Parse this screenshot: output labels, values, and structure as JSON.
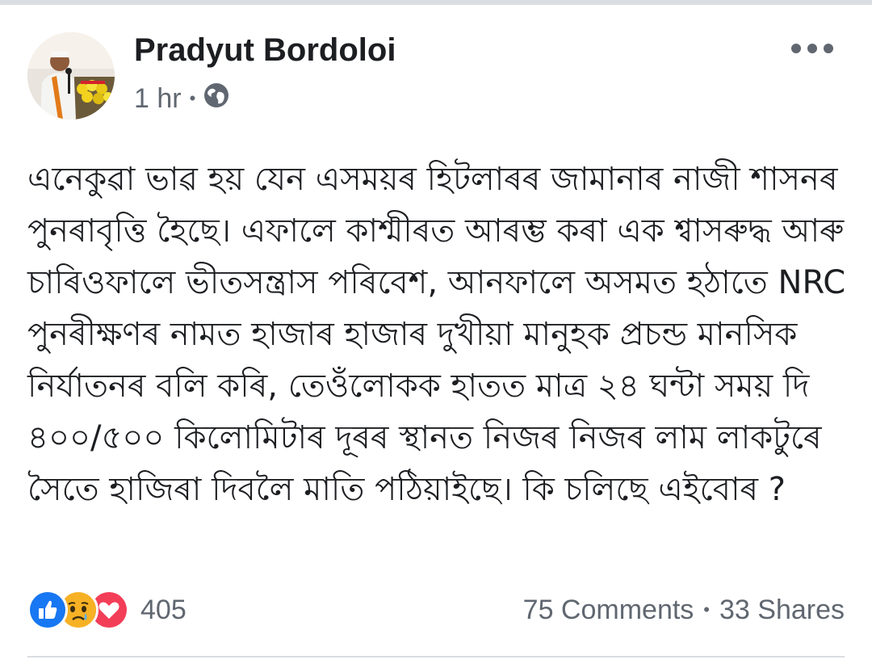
{
  "post": {
    "author": "Pradyut Bordoloi",
    "time": "1 hr",
    "separator": "•",
    "privacy_icon": "globe-icon",
    "text": "এনেকুৱা ভাৱ হয় যেন এসময়ৰ হিটলাৰৰ জামানাৰ নাজী শাসনৰ পুনৰাবৃত্তি হৈছে। এফালে কাশ্মীৰত আৰম্ভ কৰা এক শ্বাসৰুদ্ধ আৰু চাৰিওফালে ভীতসন্ত্ৰাস পৰিবেশ, আনফালে অসমত হঠাতে NRC পুনৰীক্ষণৰ নামত হাজাৰ হাজাৰ দুখীয়া মানুহক প্ৰচন্ড মানসিক নিৰ্যাতনৰ বলি কৰি, তেওঁলোকক হাতত মাত্ৰ ২৪ ঘন্টা সময় দি ৪০০/৫০০ কিলোমিটাৰ দূৰৰ স্থানত নিজৰ নিজৰ লাম লাকটুৰে সৈতে হাজিৰা দিবলৈ মাতি পঠিয়াইছে। কি চলিছে এইবোৰ ?"
  },
  "reactions": {
    "icons": [
      "like-icon",
      "sad-icon",
      "love-icon"
    ],
    "count": "405"
  },
  "stats": {
    "comments": "75 Comments",
    "separator": "•",
    "shares": "33 Shares"
  },
  "colors": {
    "text": "#1c1e21",
    "secondary": "#606770",
    "like_blue": "#1877f2",
    "love_red": "#f33e58",
    "sad_yellow": "#f7b125"
  }
}
